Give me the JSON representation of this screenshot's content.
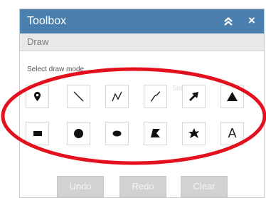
{
  "toolbox": {
    "title": "Toolbox",
    "close_symbol": "×",
    "section_label": "Draw",
    "instructions": "Select draw mode",
    "watermark": "Snipbot",
    "draw_tools_row1": [
      {
        "icon": "point-icon",
        "label": ""
      },
      {
        "icon": "line-icon",
        "label": ""
      },
      {
        "icon": "polyline-icon",
        "label": ""
      },
      {
        "icon": "freehand-polyline-icon",
        "label": ""
      },
      {
        "icon": "arrow-icon",
        "label": ""
      },
      {
        "icon": "triangle-icon",
        "label": ""
      }
    ],
    "draw_tools_row2": [
      {
        "icon": "rectangle-icon",
        "label": ""
      },
      {
        "icon": "circle-icon",
        "label": ""
      },
      {
        "icon": "ellipse-icon",
        "label": ""
      },
      {
        "icon": "polygon-icon",
        "label": ""
      },
      {
        "icon": "freehand-polygon-icon",
        "label": ""
      },
      {
        "icon": "text-icon",
        "label": "A"
      }
    ],
    "buttons": {
      "undo": "Undo",
      "redo": "Redo",
      "clear": "Clear"
    }
  },
  "colors": {
    "titlebar": "#4b7fad",
    "subheader": "#e9e9e9",
    "disabled_button": "#d2d2d2",
    "highlight_ring": "#e3111d"
  }
}
